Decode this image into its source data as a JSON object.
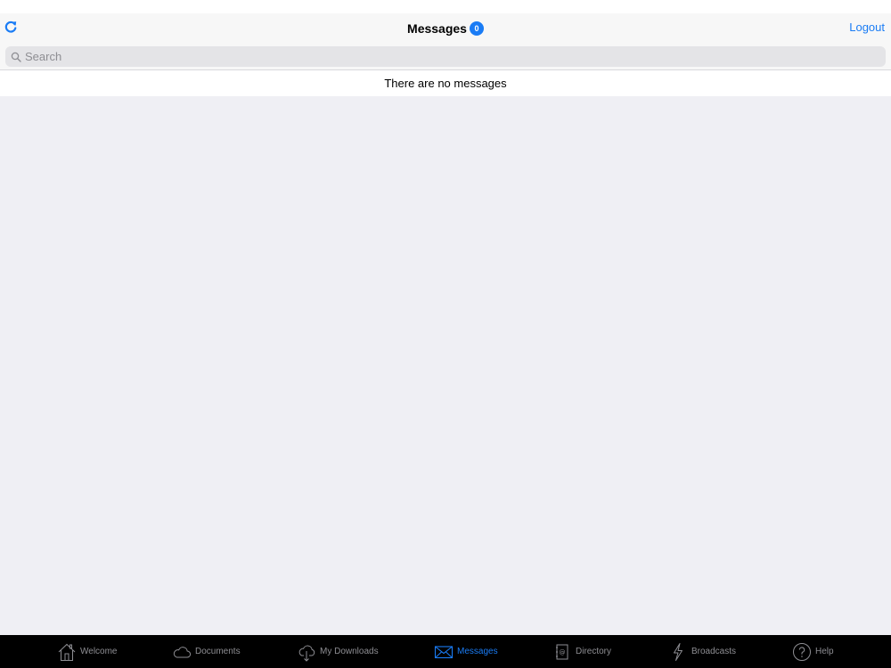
{
  "colors": {
    "accent": "#1a7cf5",
    "tab_inactive": "#8e8e93",
    "tab_bar_bg": "#000000",
    "content_bg": "#efeff4"
  },
  "header": {
    "refresh_icon": "refresh-icon",
    "title": "Messages",
    "badge_count": "0",
    "logout_label": "Logout"
  },
  "search": {
    "placeholder": "Search",
    "value": ""
  },
  "messages": {
    "empty_text": "There are no messages"
  },
  "tabs": [
    {
      "label": "Welcome",
      "icon": "home-icon",
      "active": false
    },
    {
      "label": "Documents",
      "icon": "cloud-icon",
      "active": false
    },
    {
      "label": "My Downloads",
      "icon": "cloud-download-icon",
      "active": false
    },
    {
      "label": "Messages",
      "icon": "envelope-icon",
      "active": true
    },
    {
      "label": "Directory",
      "icon": "address-book-icon",
      "active": false
    },
    {
      "label": "Broadcasts",
      "icon": "lightning-icon",
      "active": false
    },
    {
      "label": "Help",
      "icon": "help-icon",
      "active": false
    }
  ]
}
